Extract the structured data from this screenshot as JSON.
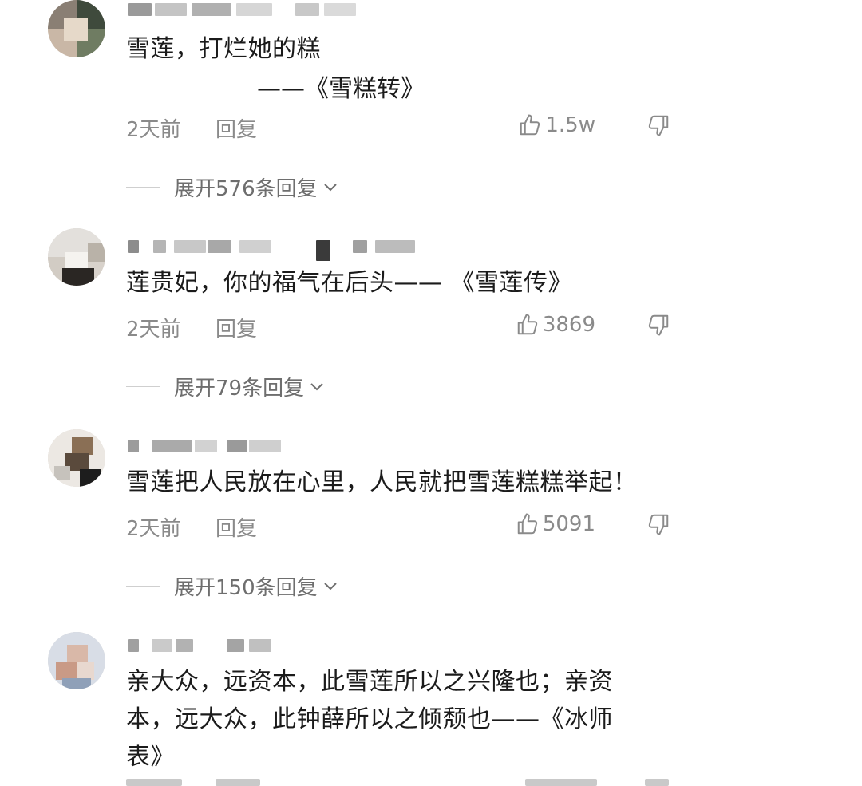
{
  "comments": [
    {
      "text": "雪莲，打烂她的糕",
      "signature": "——《雪糕转》",
      "time": "2天前",
      "reply_label": "回复",
      "likes": "1.5w",
      "expand_text": "展开576条回复"
    },
    {
      "text": "莲贵妃，你的福气在后头—— 《雪莲传》",
      "time": "2天前",
      "reply_label": "回复",
      "likes": "3869",
      "expand_text": "展开79条回复"
    },
    {
      "text": "雪莲把人民放在心里，人民就把雪莲糕糕举起！",
      "time": "2天前",
      "reply_label": "回复",
      "likes": "5091",
      "expand_text": "展开150条回复"
    },
    {
      "text_line1": "亲大众，远资本，此雪莲所以之兴隆也；亲资",
      "text_line2": "本，远大众，此钟薛所以之倾颓也——《冰师",
      "text_line3": "表》"
    }
  ],
  "icons": {
    "like": "thumbs-up-icon",
    "dislike": "thumbs-down-icon",
    "expand": "chevron-down-icon"
  },
  "colors": {
    "text": "#1b1b1b",
    "meta": "#8a8a8a",
    "expand": "#6e6e6e"
  }
}
